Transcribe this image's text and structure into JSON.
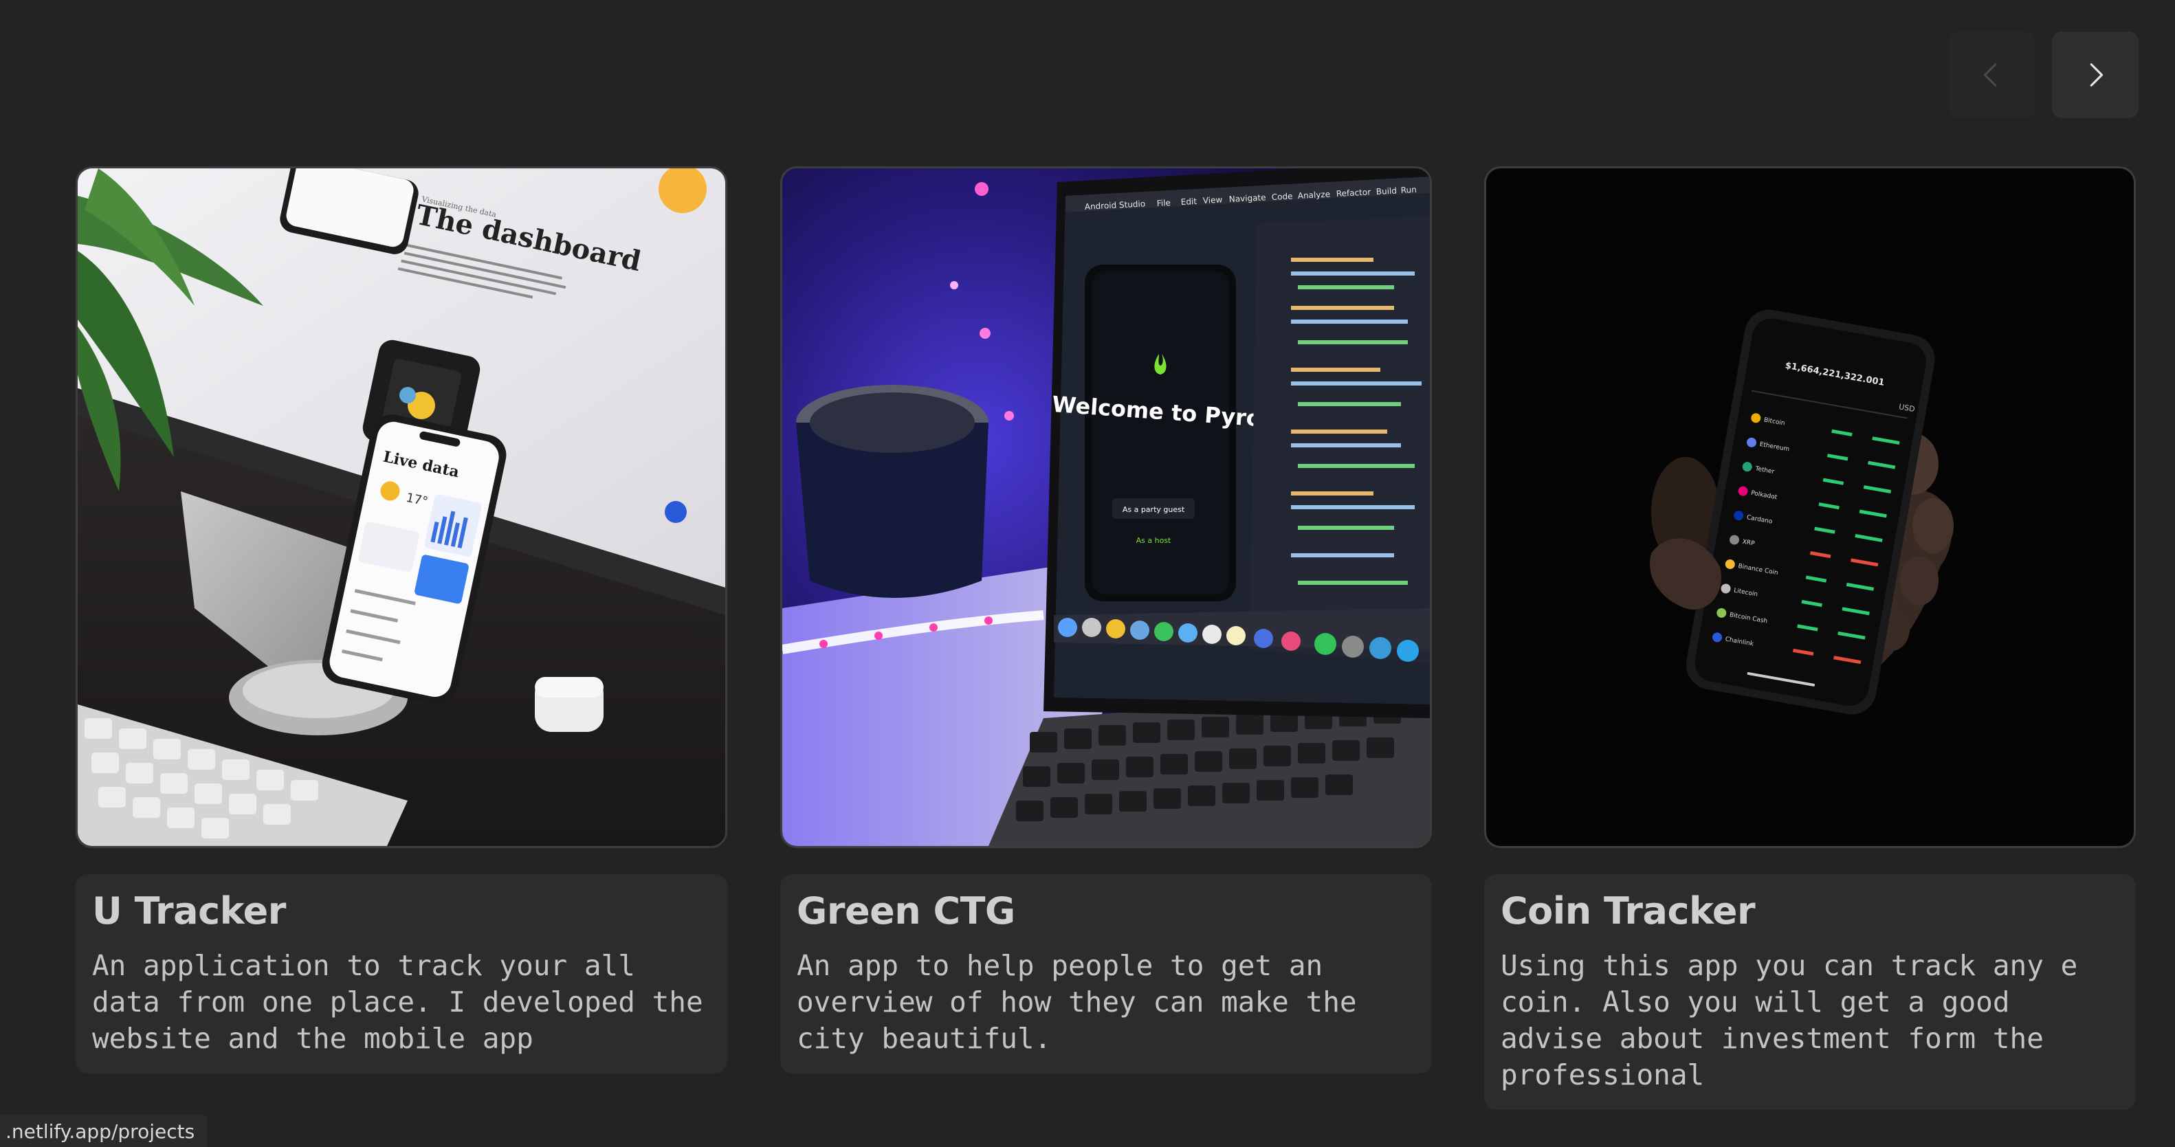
{
  "nav": {
    "prev_icon": "chevron-left-icon",
    "next_icon": "chevron-right-icon"
  },
  "projects": [
    {
      "title": "U Tracker",
      "description": "An application to track your all data from one place. I developed the website and the mobile app",
      "image": {
        "heading_small": "Visualizing the data",
        "heading": "The dashboard",
        "phone_title": "Live data",
        "temp": "17°"
      }
    },
    {
      "title": "Green CTG",
      "description": "An app to help people to get an overview of how they can make the city beautiful.",
      "image": {
        "menu": [
          "Android Studio",
          "File",
          "Edit",
          "View",
          "Navigate",
          "Code",
          "Analyze",
          "Refactor",
          "Build",
          "Run"
        ],
        "welcome": "Welcome to Pyro.",
        "btn_guest": "As a party guest",
        "btn_host": "As a host"
      }
    },
    {
      "title": "Coin Tracker",
      "description": "Using this app you can track any e coin. Also you will get a good advise about investment form the professional",
      "image": {
        "balance": "$1,664,221,322.001",
        "currency": "USD",
        "coins": [
          "Bitcoin",
          "Ethereum",
          "Tether",
          "Polkadot",
          "Cardano",
          "XRP",
          "Binance Coin",
          "Litecoin",
          "Bitcoin Cash",
          "Chainlink"
        ]
      }
    }
  ],
  "status_bar": {
    "url": ".netlify.app/projects"
  },
  "colors": {
    "background": "#232323",
    "card_info": "#2c2c2c",
    "title": "#cfcfcf",
    "text": "#c4c4c4"
  }
}
